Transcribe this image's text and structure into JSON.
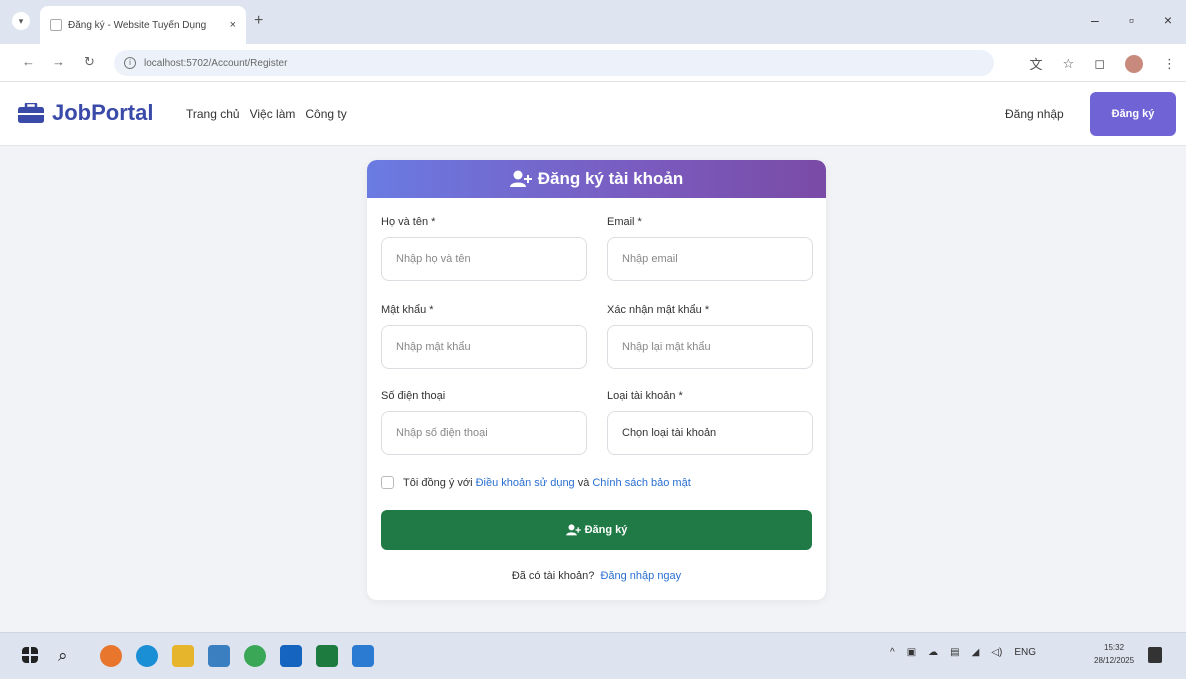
{
  "browser": {
    "tab_title": "Đăng ký - Website Tuyển Dụng",
    "url": "localhost:5702/Account/Register",
    "new_tab": "+",
    "close_tab": "×",
    "win_min": "–",
    "win_max": "▫",
    "win_close": "×"
  },
  "site": {
    "brand": "JobPortal",
    "nav": [
      "Trang chủ",
      "Việc làm",
      "Công ty"
    ],
    "login": "Đăng nhập",
    "register": "Đăng ký"
  },
  "form": {
    "title": "Đăng ký tài khoản",
    "full_name": {
      "label": "Họ và tên *",
      "placeholder": "Nhập họ và tên"
    },
    "email": {
      "label": "Email *",
      "placeholder": "Nhập email"
    },
    "password": {
      "label": "Mật khẩu *",
      "placeholder": "Nhập mật khẩu"
    },
    "confirm": {
      "label": "Xác nhận mật khẩu *",
      "placeholder": "Nhập lại mật khẩu"
    },
    "phone": {
      "label": "Số điện thoại",
      "placeholder": "Nhập số điện thoại"
    },
    "account_type": {
      "label": "Loại tài khoản *",
      "value": "Chọn loại tài khoản"
    },
    "agree_prefix": "Tôi đồng ý với",
    "terms": "Điều khoản sử dụng",
    "agree_and": "và",
    "privacy": "Chính sách bảo mật",
    "submit": "Đăng ký",
    "have_account": "Đã có tài khoản?",
    "login_now": "Đăng nhập ngay"
  },
  "taskbar": {
    "lang": "ENG",
    "time": "15:32",
    "date": "28/12/2025"
  },
  "colors": {
    "brand": "#3a4aa8",
    "register_btn": "#6f63d6",
    "submit_btn": "#1f7a45",
    "link": "#2a6fd1"
  }
}
